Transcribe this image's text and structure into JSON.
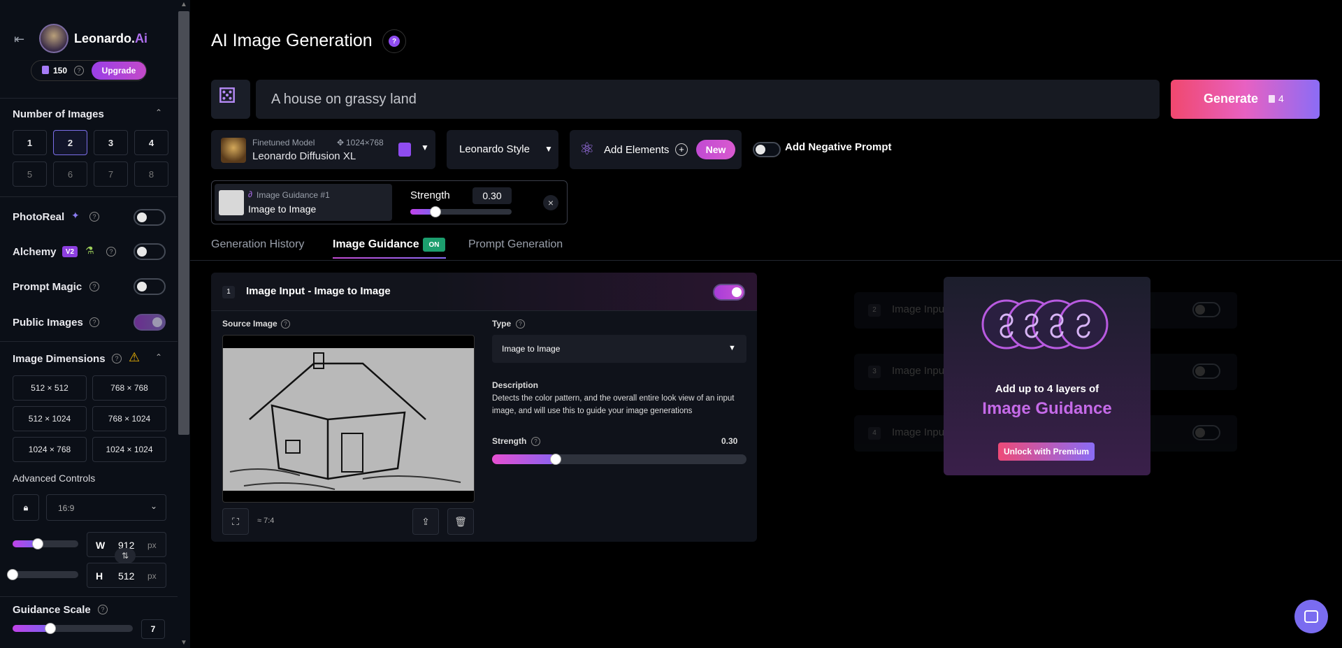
{
  "sidebar": {
    "brand_name": "Leonardo.",
    "brand_suffix": "Ai",
    "tokens": "150",
    "upgrade_label": "Upgrade",
    "number_of_images": {
      "title": "Number of Images",
      "options": [
        "1",
        "2",
        "3",
        "4",
        "5",
        "6",
        "7",
        "8"
      ],
      "selected": "2"
    },
    "photoreal_label": "PhotoReal",
    "alchemy_label": "Alchemy",
    "alchemy_badge": "V2",
    "prompt_magic_label": "Prompt Magic",
    "public_images_label": "Public Images",
    "image_dimensions": {
      "title": "Image Dimensions",
      "options": [
        "512 × 512",
        "768 × 768",
        "512 × 1024",
        "768 × 1024",
        "1024 × 768",
        "1024 × 1024"
      ]
    },
    "advanced_controls_label": "Advanced Controls",
    "aspect_ratio": "16:9",
    "width_label": "W",
    "width_value": "912",
    "height_label": "H",
    "height_value": "512",
    "px_unit": "px",
    "guidance_scale_label": "Guidance Scale",
    "guidance_scale_value": "7"
  },
  "header": {
    "title": "AI Image Generation",
    "prompt_placeholder": "A house on grassy land",
    "generate_label": "Generate",
    "generate_cost": "4"
  },
  "model": {
    "caption": "Finetuned Model",
    "dims": "1024×768",
    "name": "Leonardo Diffusion XL",
    "style": "Leonardo Style",
    "add_elements_label": "Add Elements",
    "new_badge": "New",
    "negative_prompt_label": "Add Negative Prompt"
  },
  "guidance_chip": {
    "caption": "Image Guidance #1",
    "name": "Image to Image",
    "strength_label": "Strength",
    "strength_value": "0.30",
    "close": "×"
  },
  "tabs": [
    {
      "label": "Generation History"
    },
    {
      "label": "Image Guidance",
      "badge": "ON"
    },
    {
      "label": "Prompt Generation"
    }
  ],
  "image_input": {
    "index": "1",
    "title": "Image Input - Image to Image",
    "source_image_label": "Source Image",
    "ratio": "≈ 7:4",
    "type_label": "Type",
    "type_value": "Image to Image",
    "description_label": "Description",
    "description_text": "Detects the color pattern, and the overall entire look view of an input image, and will use this to guide your image generations",
    "strength_label": "Strength",
    "strength_value": "0.30",
    "strength_fraction": 0.25
  },
  "locked_layers": [
    {
      "index": "2",
      "label": "Image Input"
    },
    {
      "index": "3",
      "label": "Image Input"
    },
    {
      "index": "4",
      "label": "Image Input"
    }
  ],
  "premium": {
    "line1": "Add up to 4 layers of",
    "line2": "Image Guidance",
    "unlock_label": "Unlock with Premium"
  },
  "colors": {
    "accent_purple": "#8f4cf0",
    "generate_gradient_start": "#f0486e",
    "generate_gradient_end": "#e861c2",
    "on_badge": "#1c9e6e"
  }
}
